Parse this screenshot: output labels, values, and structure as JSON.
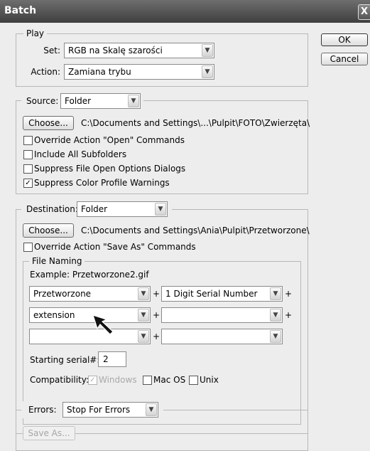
{
  "window": {
    "title": "Batch",
    "close_glyph": "X"
  },
  "buttons": {
    "ok": "OK",
    "cancel": "Cancel"
  },
  "play": {
    "legend": "Play",
    "set_label": "Set:",
    "set_value": "RGB na Skalę szarości",
    "action_label": "Action:",
    "action_value": "Zamiana trybu"
  },
  "source": {
    "label": "Source:",
    "value": "Folder",
    "choose_label": "Choose...",
    "path": "C:\\Documents and Settings\\...\\Pulpit\\FOTO\\Zwierzęta\\",
    "options": [
      {
        "label": "Override Action \"Open\" Commands",
        "checked": false
      },
      {
        "label": "Include All Subfolders",
        "checked": false
      },
      {
        "label": "Suppress File Open Options Dialogs",
        "checked": false
      },
      {
        "label": "Suppress Color Profile Warnings",
        "checked": true
      }
    ]
  },
  "destination": {
    "label": "Destination:",
    "value": "Folder",
    "choose_label": "Choose...",
    "path": "C:\\Documents and Settings\\Ania\\Pulpit\\Przetworzone\\",
    "override_label": "Override Action \"Save As\" Commands",
    "override_checked": false,
    "file_naming": {
      "legend": "File Naming",
      "example": "Example: Przetworzone2.gif",
      "rows": [
        {
          "left": "Przetworzone",
          "right": "1 Digit Serial Number"
        },
        {
          "left": "extension",
          "right": ""
        },
        {
          "left": "",
          "right": ""
        }
      ],
      "plus": "+",
      "serial_label": "Starting serial#:",
      "serial_value": "2",
      "compat_label": "Compatibility:",
      "compat": [
        {
          "label": "Windows",
          "checked": true,
          "disabled": true
        },
        {
          "label": "Mac OS",
          "checked": false,
          "disabled": false
        },
        {
          "label": "Unix",
          "checked": false,
          "disabled": false
        }
      ]
    }
  },
  "errors": {
    "label": "Errors:",
    "value": "Stop For Errors",
    "save_as_label": "Save As..."
  },
  "icons": {
    "check": "✓",
    "dropdown": "▼"
  }
}
